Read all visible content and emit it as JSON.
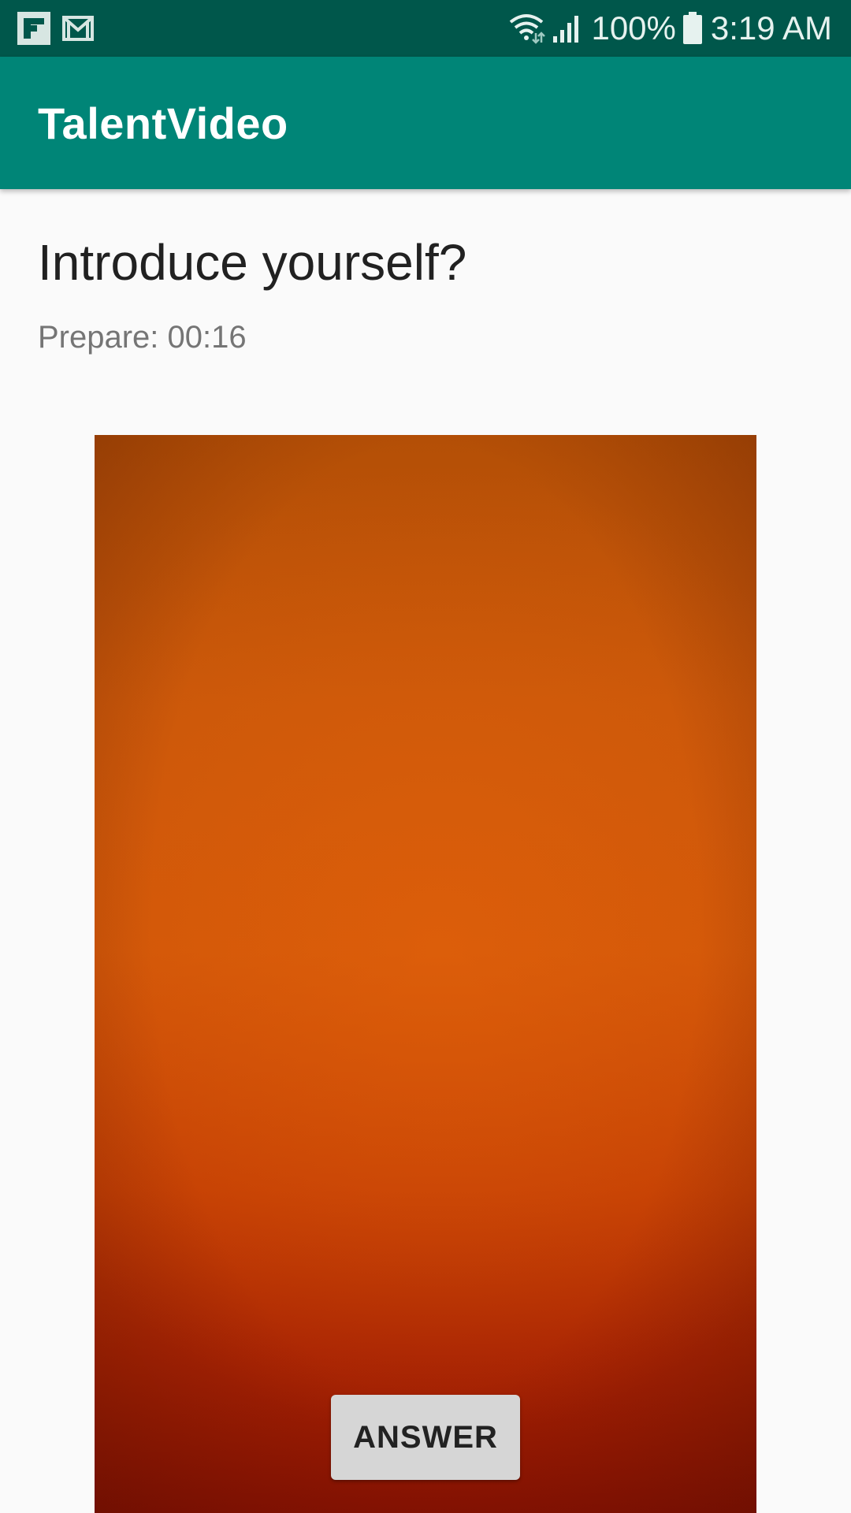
{
  "status_bar": {
    "left_icons": [
      "flipboard-icon",
      "gmail-icon"
    ],
    "right_icons": [
      "wifi-icon",
      "signal-icon",
      "battery-icon"
    ],
    "battery": "100%",
    "time": "3:19 AM"
  },
  "app_bar": {
    "title": "TalentVideo"
  },
  "content": {
    "question": "Introduce yourself?",
    "timer": "Prepare: 00:16"
  },
  "camera": {
    "answer_label": "ANSWER"
  },
  "colors": {
    "status_bar": "#00574b",
    "app_bar": "#008577",
    "background": "#fafafa",
    "button": "#d6d6d6"
  }
}
